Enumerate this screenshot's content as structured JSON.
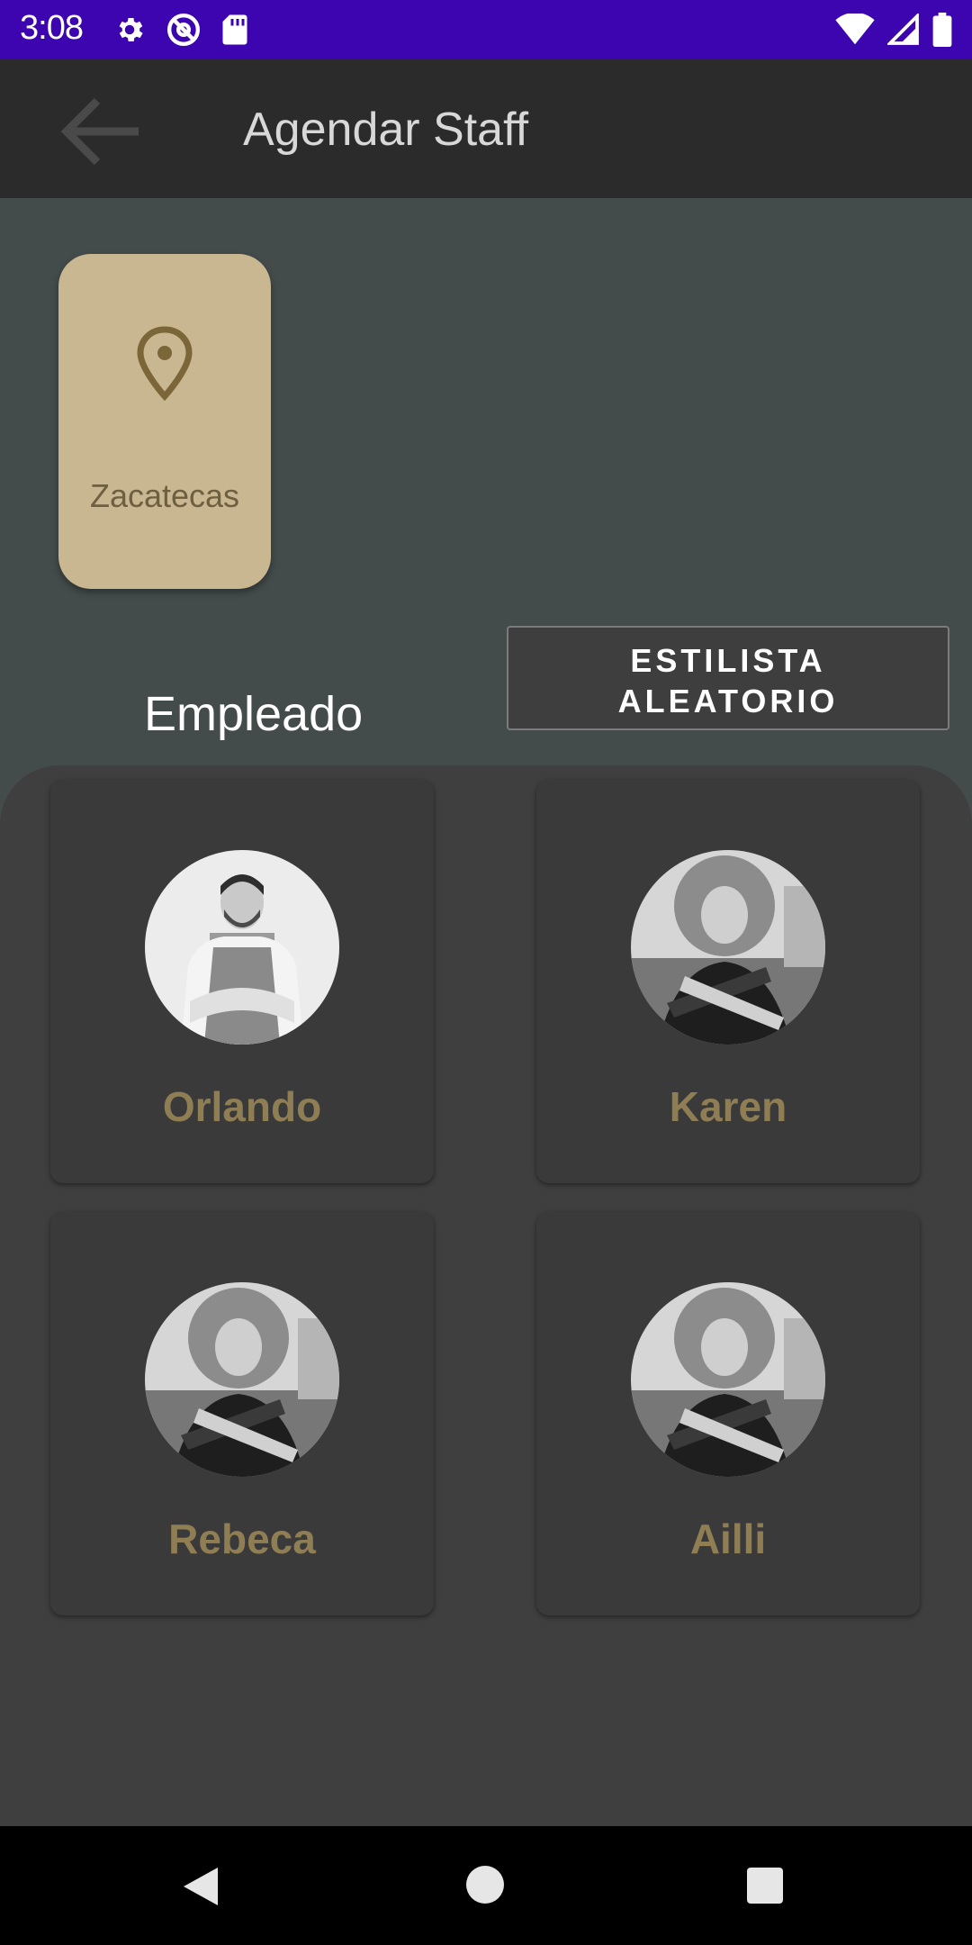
{
  "status_bar": {
    "time": "3:08",
    "icons_left": [
      "settings-icon",
      "at-sign-icon",
      "sd-card-icon"
    ],
    "icons_right": [
      "wifi-icon",
      "signal-icon",
      "battery-icon"
    ]
  },
  "app_bar": {
    "title": "Agendar Staff",
    "back_icon": "arrow-back-icon"
  },
  "location": {
    "icon": "location-pin-icon",
    "label": "Zacatecas"
  },
  "random_button": {
    "line1": "ESTILISTA",
    "line2": "ALEATORIO"
  },
  "section_label": "Empleado",
  "staff": [
    {
      "name": "Orlando"
    },
    {
      "name": "Karen"
    },
    {
      "name": "Rebeca"
    },
    {
      "name": "Ailli"
    }
  ],
  "colors": {
    "status_bar": "#3c05b0",
    "app_bar": "#2b2b2b",
    "background": "#434b4b",
    "location_card": "#c9b791",
    "staff_name": "#8f7d54"
  }
}
